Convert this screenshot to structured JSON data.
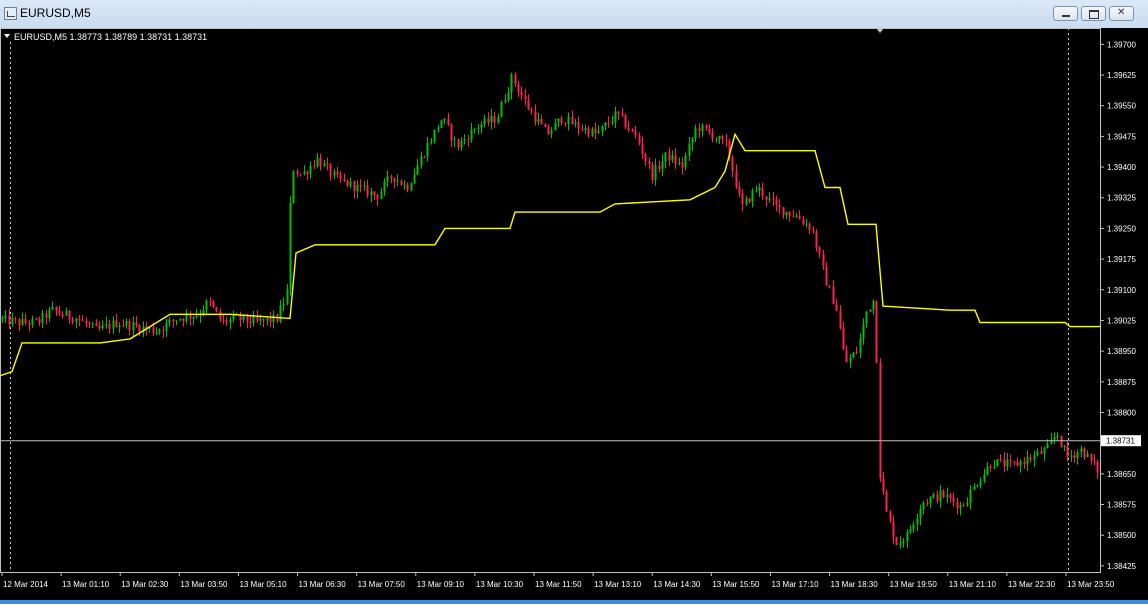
{
  "window": {
    "title": "EURUSD,M5",
    "icon": "chart-window-icon"
  },
  "header_info": "EURUSD,M5  1.38773 1.38789 1.38731 1.38731",
  "colors": {
    "background": "#000000",
    "bull_candle": "#00c000",
    "bear_candle": "#ff2050",
    "indicator": "#ffff00",
    "price_line": "#c0c0c0"
  },
  "current_price_label": "1.38731",
  "chart_data": {
    "type": "candlestick",
    "symbol": "EURUSD",
    "timeframe": "M5",
    "last_bar": {
      "open": 1.38773,
      "high": 1.38789,
      "low": 1.38731,
      "close": 1.38731
    },
    "current_price": 1.38731,
    "ylim": [
      1.3841,
      1.3974
    ],
    "y_ticks": [
      "1.39700",
      "1.39625",
      "1.39550",
      "1.39475",
      "1.39400",
      "1.39325",
      "1.39250",
      "1.39175",
      "1.39100",
      "1.39025",
      "1.38950",
      "1.38875",
      "1.38800",
      "1.38731",
      "1.38650",
      "1.38575",
      "1.38500",
      "1.38425"
    ],
    "x_ticks": [
      "12 Mar 2014",
      "13 Mar 01:10",
      "13 Mar 02:30",
      "13 Mar 03:50",
      "13 Mar 05:10",
      "13 Mar 06:30",
      "13 Mar 07:50",
      "13 Mar 09:10",
      "13 Mar 10:30",
      "13 Mar 11:50",
      "13 Mar 13:10",
      "13 Mar 14:30",
      "13 Mar 15:50",
      "13 Mar 17:10",
      "13 Mar 18:30",
      "13 Mar 19:50",
      "13 Mar 21:10",
      "13 Mar 22:30",
      "13 Mar 23:50"
    ],
    "price_path": [
      [
        0,
        1.3903
      ],
      [
        20,
        1.3902
      ],
      [
        40,
        1.3902
      ],
      [
        55,
        1.3905
      ],
      [
        65,
        1.3904
      ],
      [
        80,
        1.3903
      ],
      [
        100,
        1.39
      ],
      [
        120,
        1.3902
      ],
      [
        140,
        1.3901
      ],
      [
        160,
        1.39
      ],
      [
        180,
        1.3903
      ],
      [
        200,
        1.3904
      ],
      [
        212,
        1.3907
      ],
      [
        225,
        1.3902
      ],
      [
        240,
        1.3903
      ],
      [
        260,
        1.3902
      ],
      [
        280,
        1.3903
      ],
      [
        290,
        1.3909
      ],
      [
        295,
        1.394
      ],
      [
        305,
        1.3938
      ],
      [
        320,
        1.3942
      ],
      [
        340,
        1.3937
      ],
      [
        360,
        1.3935
      ],
      [
        380,
        1.3933
      ],
      [
        395,
        1.3938
      ],
      [
        410,
        1.3935
      ],
      [
        430,
        1.3945
      ],
      [
        445,
        1.3952
      ],
      [
        460,
        1.3945
      ],
      [
        480,
        1.395
      ],
      [
        500,
        1.3952
      ],
      [
        515,
        1.3962
      ],
      [
        530,
        1.3955
      ],
      [
        550,
        1.3948
      ],
      [
        565,
        1.3952
      ],
      [
        580,
        1.395
      ],
      [
        600,
        1.3948
      ],
      [
        620,
        1.3953
      ],
      [
        640,
        1.3947
      ],
      [
        655,
        1.3938
      ],
      [
        670,
        1.3943
      ],
      [
        685,
        1.394
      ],
      [
        700,
        1.395
      ],
      [
        715,
        1.3948
      ],
      [
        730,
        1.3945
      ],
      [
        745,
        1.393
      ],
      [
        760,
        1.3935
      ],
      [
        780,
        1.393
      ],
      [
        800,
        1.3928
      ],
      [
        815,
        1.3925
      ],
      [
        828,
        1.3913
      ],
      [
        840,
        1.3905
      ],
      [
        848,
        1.3892
      ],
      [
        860,
        1.3895
      ],
      [
        870,
        1.3905
      ],
      [
        878,
        1.3908
      ],
      [
        883,
        1.3865
      ],
      [
        890,
        1.3855
      ],
      [
        900,
        1.3848
      ],
      [
        910,
        1.385
      ],
      [
        925,
        1.3858
      ],
      [
        945,
        1.386
      ],
      [
        965,
        1.3857
      ],
      [
        980,
        1.3863
      ],
      [
        995,
        1.3868
      ],
      [
        1015,
        1.3867
      ],
      [
        1035,
        1.3869
      ],
      [
        1050,
        1.3871
      ],
      [
        1060,
        1.3875
      ],
      [
        1070,
        1.3869
      ],
      [
        1085,
        1.3871
      ],
      [
        1100,
        1.3866
      ]
    ],
    "indicator_path": [
      [
        0,
        1.3889
      ],
      [
        12,
        1.389
      ],
      [
        22,
        1.3897
      ],
      [
        60,
        1.3897
      ],
      [
        100,
        1.3897
      ],
      [
        130,
        1.3898
      ],
      [
        150,
        1.3901
      ],
      [
        170,
        1.3904
      ],
      [
        230,
        1.3904
      ],
      [
        290,
        1.3903
      ],
      [
        296,
        1.3919
      ],
      [
        315,
        1.3921
      ],
      [
        435,
        1.3921
      ],
      [
        445,
        1.3925
      ],
      [
        510,
        1.3925
      ],
      [
        515,
        1.3929
      ],
      [
        600,
        1.3929
      ],
      [
        615,
        1.3931
      ],
      [
        690,
        1.3932
      ],
      [
        715,
        1.3935
      ],
      [
        725,
        1.3939
      ],
      [
        735,
        1.3948
      ],
      [
        745,
        1.3944
      ],
      [
        815,
        1.3944
      ],
      [
        825,
        1.3935
      ],
      [
        840,
        1.3935
      ],
      [
        848,
        1.3926
      ],
      [
        876,
        1.3926
      ],
      [
        883,
        1.3906
      ],
      [
        950,
        1.3905
      ],
      [
        975,
        1.3905
      ],
      [
        980,
        1.3902
      ],
      [
        1065,
        1.3902
      ],
      [
        1070,
        1.3901
      ],
      [
        1100,
        1.3901
      ]
    ]
  }
}
